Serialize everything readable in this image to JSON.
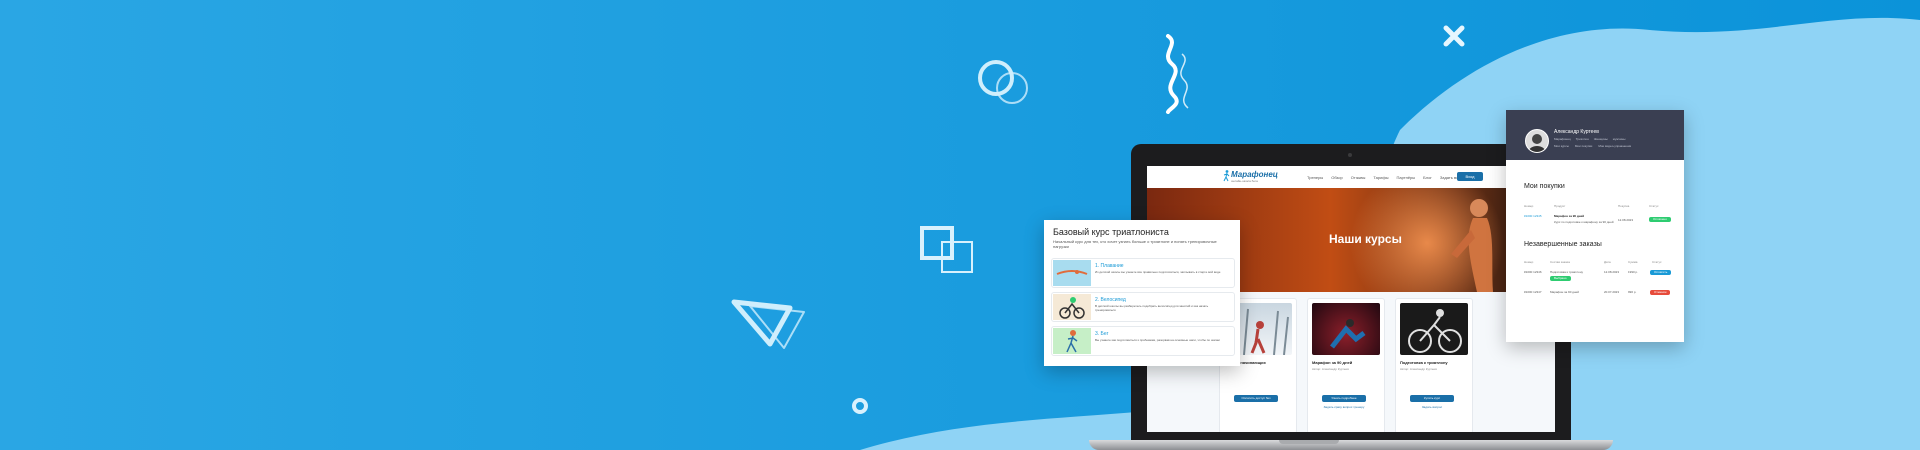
{
  "colors": {
    "bg_left": "#1e9fe0",
    "bg_right": "#8fd3f5",
    "accent": "#1a6fa8",
    "green": "#2ecc71",
    "red": "#e74c3c",
    "blue": "#1a9ad6"
  },
  "decor": [
    "circles-icon",
    "squiggle-icon",
    "close-icon",
    "squares-icon",
    "triangle-icon",
    "ring-icon"
  ],
  "site": {
    "logo": "Марафонец",
    "logo_sub": "онлайн-школа бега",
    "nav": [
      "Тренеры",
      "Обзор",
      "Отзывы",
      "Тарифы",
      "Партнёры",
      "Блог",
      "Задать вопрос"
    ],
    "login": "Вход",
    "hero_title": "Наши курсы",
    "cards": [
      {
        "title": "Бег для начинающих",
        "sub": "",
        "text": "",
        "btn": "Оплатить доступ без ограничений",
        "link": "",
        "img": "snow"
      },
      {
        "title": "Марафон за 90 дней",
        "sub": "Автор: Александр Куртеев",
        "text": "",
        "btn": "Узнать подробнее",
        "link": "Задать сразу вопрос тренеру",
        "img": "dark"
      },
      {
        "title": "Подготовка к триатлону",
        "sub": "Автор: Александр Куртеев",
        "text": "",
        "btn": "Купить курс",
        "link": "Задать вопрос",
        "img": "bike"
      }
    ]
  },
  "course": {
    "title": "Базовый курс триатлониста",
    "desc": "Начальный курс для тех, кто хочет узнать больше о триатлоне и понять тренировочные нагрузки",
    "lessons": [
      {
        "name": "1. Плавание",
        "text": "Из детской школы вы узнаете все правильно подготовиться, заплывать в старте вой воде",
        "img": "swim"
      },
      {
        "name": "2. Велосипед",
        "text": "В детской школы вы разберетесь подобрать велосипед для занятий и как начать тренироваться",
        "img": "bike"
      },
      {
        "name": "3. Бег",
        "text": "Вы узнаете как подготовиться к пробежкам, разорвав на основные шаги, чтобы по шагам",
        "img": "run"
      }
    ]
  },
  "purchases": {
    "name": "Александр Куртеев",
    "meta": [
      "Марафонец",
      "Триатлон",
      "Женщины",
      "мужчины"
    ],
    "stats": [
      "Мои курсы",
      "Мои покупки",
      "Мои видео-упражнения"
    ],
    "title": "Мои покупки",
    "cols": [
      "Номер",
      "Продукт",
      "Покупка",
      "Статус"
    ],
    "row": {
      "num": "#1000 12345",
      "product": "Марафон за 90 дней",
      "sub": "Курс по подготовке к марафону за 90 дней",
      "date": "12.08.2023",
      "status": "Оплачено"
    },
    "title2": "Незавершенные заказы",
    "cols2": [
      "Номер",
      "Состав заказа",
      "Дата",
      "Сумма",
      "Статус"
    ],
    "rows2": [
      {
        "num": "#1000 12346",
        "product": "Подготовка к триатлону",
        "date": "12.08.2023",
        "sum": "1990 р.",
        "status": "Оплатить",
        "badge": "Выбрано"
      },
      {
        "num": "#1000 12347",
        "product": "Марафон за 90 дней",
        "date": "20.07.2023",
        "sum": "990 р.",
        "status": "Отменён"
      }
    ]
  }
}
